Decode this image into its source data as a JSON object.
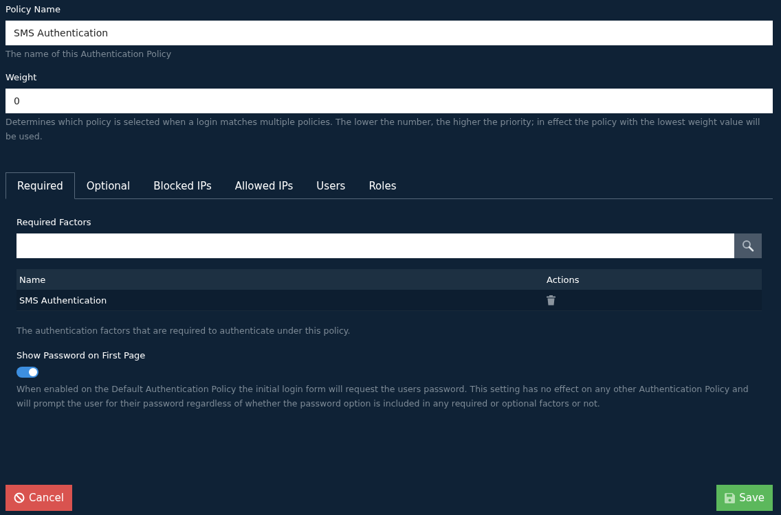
{
  "policy_name": {
    "label": "Policy Name",
    "value": "SMS Authentication",
    "help": "The name of this Authentication Policy"
  },
  "weight": {
    "label": "Weight",
    "value": "0",
    "help": "Determines which policy is selected when a login matches multiple policies. The lower the number, the higher the priority; in effect the policy with the lowest weight value will be used."
  },
  "tabs": [
    {
      "label": "Required",
      "selected": true
    },
    {
      "label": "Optional",
      "selected": false
    },
    {
      "label": "Blocked IPs",
      "selected": false
    },
    {
      "label": "Allowed IPs",
      "selected": false
    },
    {
      "label": "Users",
      "selected": false
    },
    {
      "label": "Roles",
      "selected": false
    }
  ],
  "required_factors": {
    "label": "Required Factors",
    "columns": [
      "Name",
      "Actions"
    ],
    "rows": [
      {
        "name": "SMS Authentication"
      }
    ],
    "help": "The authentication factors that are required to authenticate under this policy."
  },
  "show_password": {
    "label": "Show Password on First Page",
    "on": true,
    "help": "When enabled on the Default Authentication Policy the initial login form will request the users password. This setting has no effect on any other Authentication Policy and will prompt the user for their password regardless of whether the password option is included in any required or optional factors or not."
  },
  "buttons": {
    "cancel": "Cancel",
    "save": "Save"
  }
}
